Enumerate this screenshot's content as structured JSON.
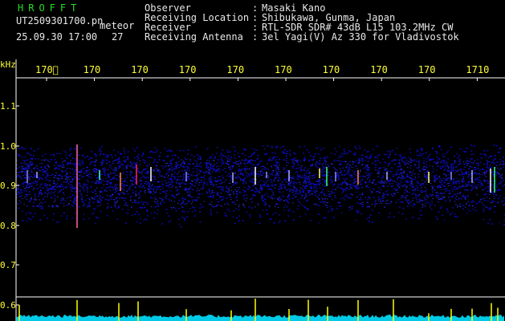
{
  "header": {
    "program": "HROFFT",
    "filename": "UT2509301700.pn",
    "label": "meteor",
    "timestamp": "25.09.30 17:00",
    "count": "27",
    "fields": [
      {
        "key": "Observer",
        "sep": ":",
        "value": "Masaki Kano"
      },
      {
        "key": "Receiving Location",
        "sep": ":",
        "value": "Shibukawa, Gunma, Japan"
      },
      {
        "key": "Receiver",
        "sep": ":",
        "value": "RTL-SDR SDR# 43dB L15 103.2MHz CW"
      },
      {
        "key": "Receiving Antenna",
        "sep": ":",
        "value": "3el Yagi(V) Az 330 for Vladivostok"
      }
    ]
  },
  "axes": {
    "y_unit": "kHz",
    "y_ticks": [
      "1.1",
      "1.0",
      "0.9",
      "0.8",
      "0.7",
      "0.6"
    ],
    "x_ticks": [
      "170\u0000",
      "170\u0002",
      "170\u0003",
      "170\u0004",
      "170\u0005",
      "170\u0006",
      "170\u0007",
      "170\b",
      "170\t",
      "1710"
    ]
  },
  "colors": {
    "background": "#000000",
    "header_green": "#22dd22",
    "header_white": "#e8e8e8",
    "tick_yellow": "#ffff33",
    "noise_band": "#1a1aa0",
    "power_trace": "#00e0ff",
    "power_spike": "#ffff00"
  }
}
